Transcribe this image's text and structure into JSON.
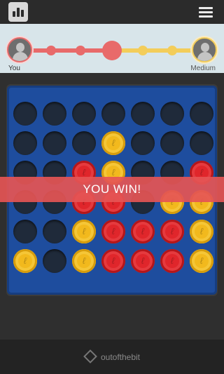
{
  "header": {
    "logo_icon": "four-in-a-row-logo-icon",
    "menu_icon": "hamburger-menu-icon"
  },
  "players": {
    "you_label": "You",
    "opponent_label": "Medium"
  },
  "board": {
    "rows": 6,
    "cols": 7,
    "cells": [
      [
        "empty",
        "empty",
        "empty",
        "empty",
        "empty",
        "empty",
        "empty"
      ],
      [
        "empty",
        "empty",
        "empty",
        "yellow",
        "empty",
        "empty",
        "empty"
      ],
      [
        "empty",
        "empty",
        "red",
        "yellow",
        "empty",
        "empty",
        "red"
      ],
      [
        "empty",
        "empty",
        "red",
        "red",
        "empty",
        "yellow",
        "yellow"
      ],
      [
        "empty",
        "empty",
        "yellow",
        "red",
        "red",
        "red",
        "yellow"
      ],
      [
        "yellow",
        "empty",
        "yellow",
        "red",
        "red",
        "red",
        "yellow"
      ]
    ],
    "colors": {
      "red": "#e0262b",
      "yellow": "#f2b91d",
      "board": "#1e4d9e"
    }
  },
  "banner": {
    "text": "YOU WIN!"
  },
  "footer": {
    "brand": "outofthebit"
  }
}
